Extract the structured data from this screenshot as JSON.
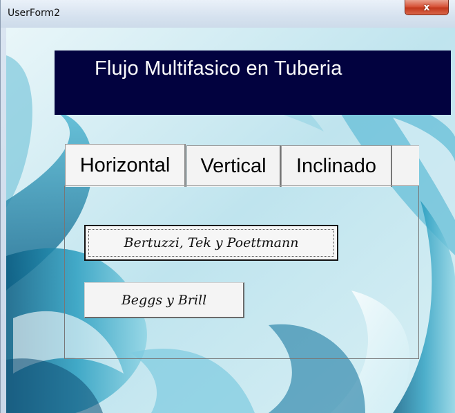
{
  "window": {
    "title": "UserForm2",
    "close_label": "x"
  },
  "banner": {
    "title": "Flujo Multifasico en Tuberia",
    "background": "#02023f"
  },
  "tabs": [
    {
      "label": "Horizontal",
      "selected": true
    },
    {
      "label": "Vertical",
      "selected": false
    },
    {
      "label": "Inclinado",
      "selected": false
    }
  ],
  "buttons": {
    "bertuzzi": "Bertuzzi, Tek y Poettmann",
    "beggs": "Beggs y Brill"
  },
  "colors": {
    "titlebar": "#dbe6f2",
    "close_button": "#c8462a",
    "background_teal": "#2c8fb0"
  }
}
